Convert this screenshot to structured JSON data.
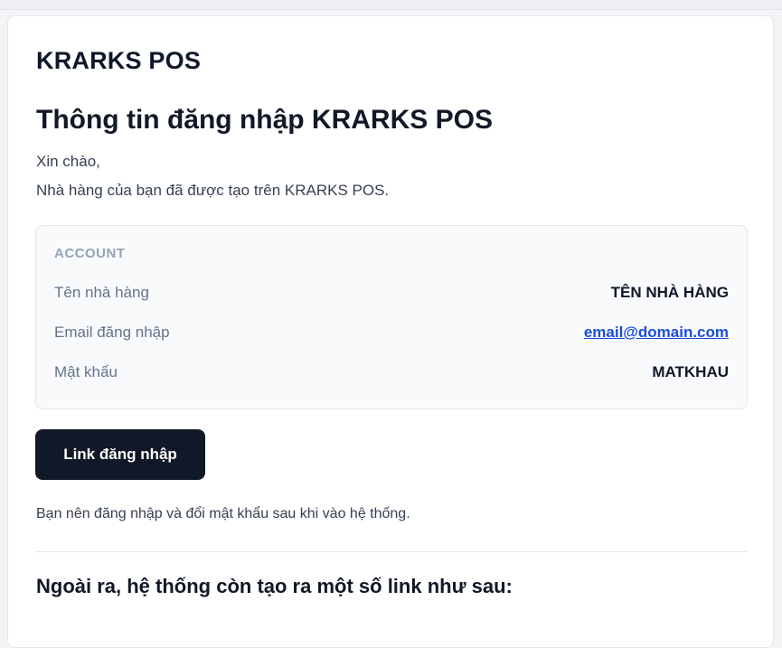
{
  "brand": "KRARKS POS",
  "title": "Thông tin đăng nhập KRARKS POS",
  "greeting": "Xin chào,",
  "intro": "Nhà hàng của bạn đã được tạo trên KRARKS POS.",
  "account": {
    "heading": "ACCOUNT",
    "rows": [
      {
        "label": "Tên nhà hàng",
        "value": "TÊN NHÀ HÀNG"
      },
      {
        "label": "Email đăng nhập",
        "value": "email@domain.com"
      },
      {
        "label": "Mật khẩu",
        "value": "MATKHAU"
      }
    ]
  },
  "login_button": "Link đăng nhập",
  "note": "Bạn nên đăng nhập và đổi mật khẩu sau khi vào hệ thống.",
  "subheading": "Ngoài ra, hệ thống còn tạo ra một số link như sau:",
  "colors": {
    "button_bg": "#111827",
    "link": "#1d4ed8",
    "muted": "#94a3b8"
  }
}
